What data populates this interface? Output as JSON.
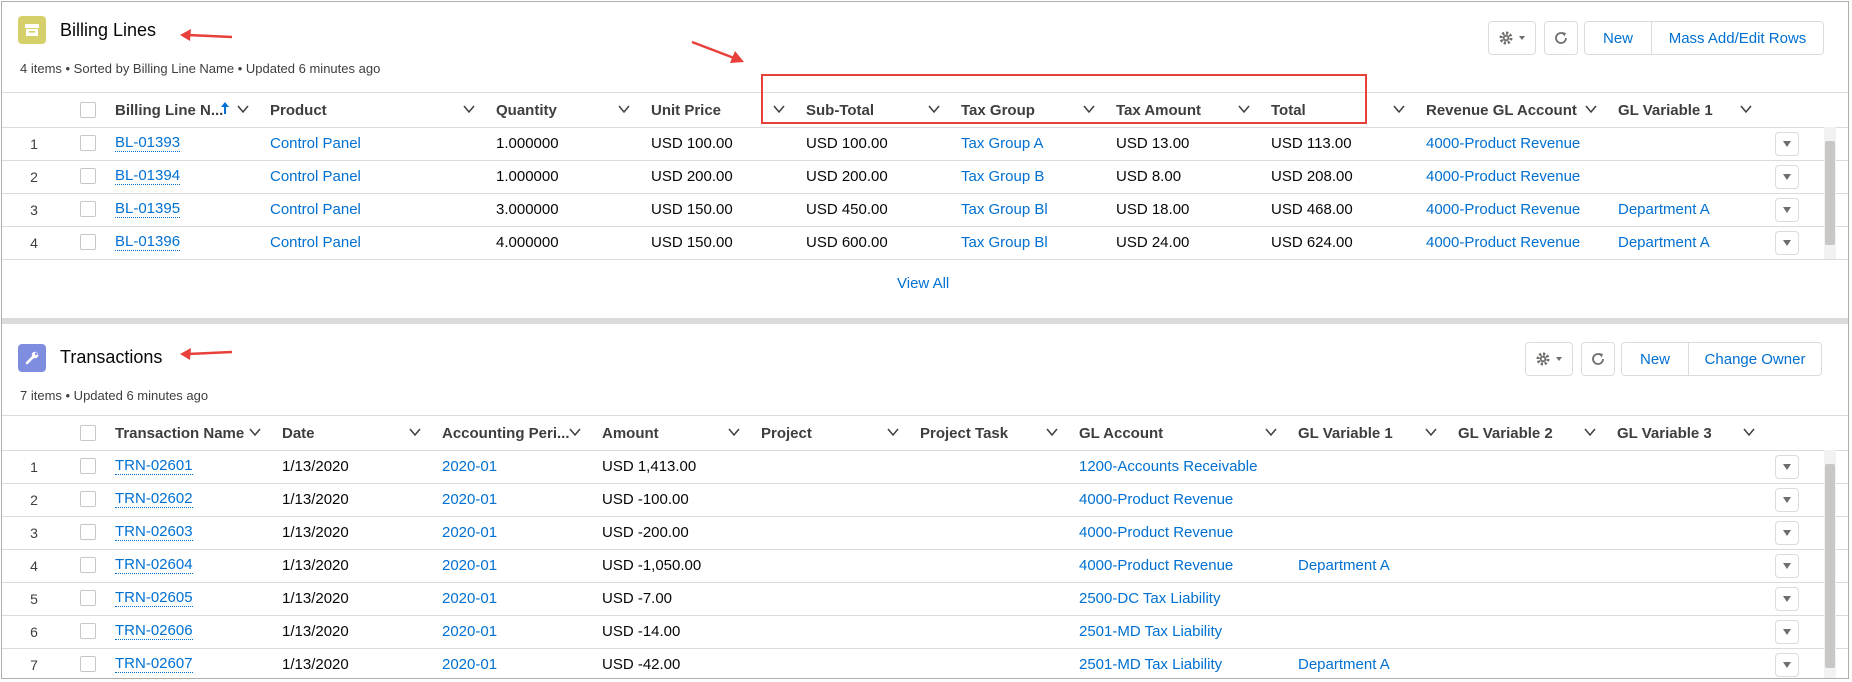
{
  "billing": {
    "title": "Billing Lines",
    "meta": "4 items • Sorted by Billing Line Name • Updated 6 minutes ago",
    "buttons": {
      "new": "New",
      "mass": "Mass Add/Edit Rows"
    },
    "columns": [
      "Billing Line N...",
      "Product",
      "Quantity",
      "Unit Price",
      "Sub-Total",
      "Tax Group",
      "Tax Amount",
      "Total",
      "Revenue GL Account",
      "GL Variable 1"
    ],
    "rows": [
      {
        "num": "1",
        "name": "BL-01393",
        "product": "Control Panel",
        "qty": "1.000000",
        "unit": "USD 100.00",
        "sub": "USD 100.00",
        "taxgroup": "Tax Group A",
        "taxamt": "USD 13.00",
        "total": "USD 113.00",
        "rev": "4000-Product Revenue",
        "glv1": ""
      },
      {
        "num": "2",
        "name": "BL-01394",
        "product": "Control Panel",
        "qty": "1.000000",
        "unit": "USD 200.00",
        "sub": "USD 200.00",
        "taxgroup": "Tax Group B",
        "taxamt": "USD 8.00",
        "total": "USD 208.00",
        "rev": "4000-Product Revenue",
        "glv1": ""
      },
      {
        "num": "3",
        "name": "BL-01395",
        "product": "Control Panel",
        "qty": "3.000000",
        "unit": "USD 150.00",
        "sub": "USD 450.00",
        "taxgroup": "Tax Group Bl",
        "taxamt": "USD 18.00",
        "total": "USD 468.00",
        "rev": "4000-Product Revenue",
        "glv1": "Department A"
      },
      {
        "num": "4",
        "name": "BL-01396",
        "product": "Control Panel",
        "qty": "4.000000",
        "unit": "USD 150.00",
        "sub": "USD 600.00",
        "taxgroup": "Tax Group Bl",
        "taxamt": "USD 24.00",
        "total": "USD 624.00",
        "rev": "4000-Product Revenue",
        "glv1": "Department A"
      }
    ],
    "view_all": "View All"
  },
  "transactions": {
    "title": "Transactions",
    "meta": "7 items • Updated 6 minutes ago",
    "buttons": {
      "new": "New",
      "change_owner": "Change Owner"
    },
    "columns": [
      "Transaction Name",
      "Date",
      "Accounting Peri...",
      "Amount",
      "Project",
      "Project Task",
      "GL Account",
      "GL Variable 1",
      "GL Variable 2",
      "GL Variable 3"
    ],
    "rows": [
      {
        "num": "1",
        "name": "TRN-02601",
        "date": "1/13/2020",
        "period": "2020-01",
        "amount": "USD 1,413.00",
        "gl": "1200-Accounts Receivable",
        "glv1": ""
      },
      {
        "num": "2",
        "name": "TRN-02602",
        "date": "1/13/2020",
        "period": "2020-01",
        "amount": "USD -100.00",
        "gl": "4000-Product Revenue",
        "glv1": ""
      },
      {
        "num": "3",
        "name": "TRN-02603",
        "date": "1/13/2020",
        "period": "2020-01",
        "amount": "USD -200.00",
        "gl": "4000-Product Revenue",
        "glv1": ""
      },
      {
        "num": "4",
        "name": "TRN-02604",
        "date": "1/13/2020",
        "period": "2020-01",
        "amount": "USD -1,050.00",
        "gl": "4000-Product Revenue",
        "glv1": "Department A"
      },
      {
        "num": "5",
        "name": "TRN-02605",
        "date": "1/13/2020",
        "period": "2020-01",
        "amount": "USD -7.00",
        "gl": "2500-DC Tax Liability",
        "glv1": ""
      },
      {
        "num": "6",
        "name": "TRN-02606",
        "date": "1/13/2020",
        "period": "2020-01",
        "amount": "USD -14.00",
        "gl": "2501-MD Tax Liability",
        "glv1": ""
      },
      {
        "num": "7",
        "name": "TRN-02607",
        "date": "1/13/2020",
        "period": "2020-01",
        "amount": "USD -42.00",
        "gl": "2501-MD Tax Liability",
        "glv1": "Department A"
      }
    ]
  },
  "colors": {
    "link": "#0070d2",
    "annotation": "#e8403b",
    "billing_icon": "#d5d06a",
    "transactions_icon": "#7f8de1"
  },
  "icons": [
    "billing-icon",
    "wrench-icon",
    "gear-icon",
    "refresh-icon",
    "chevron-down-icon",
    "sort-up-arrow-icon",
    "row-menu-icon"
  ]
}
